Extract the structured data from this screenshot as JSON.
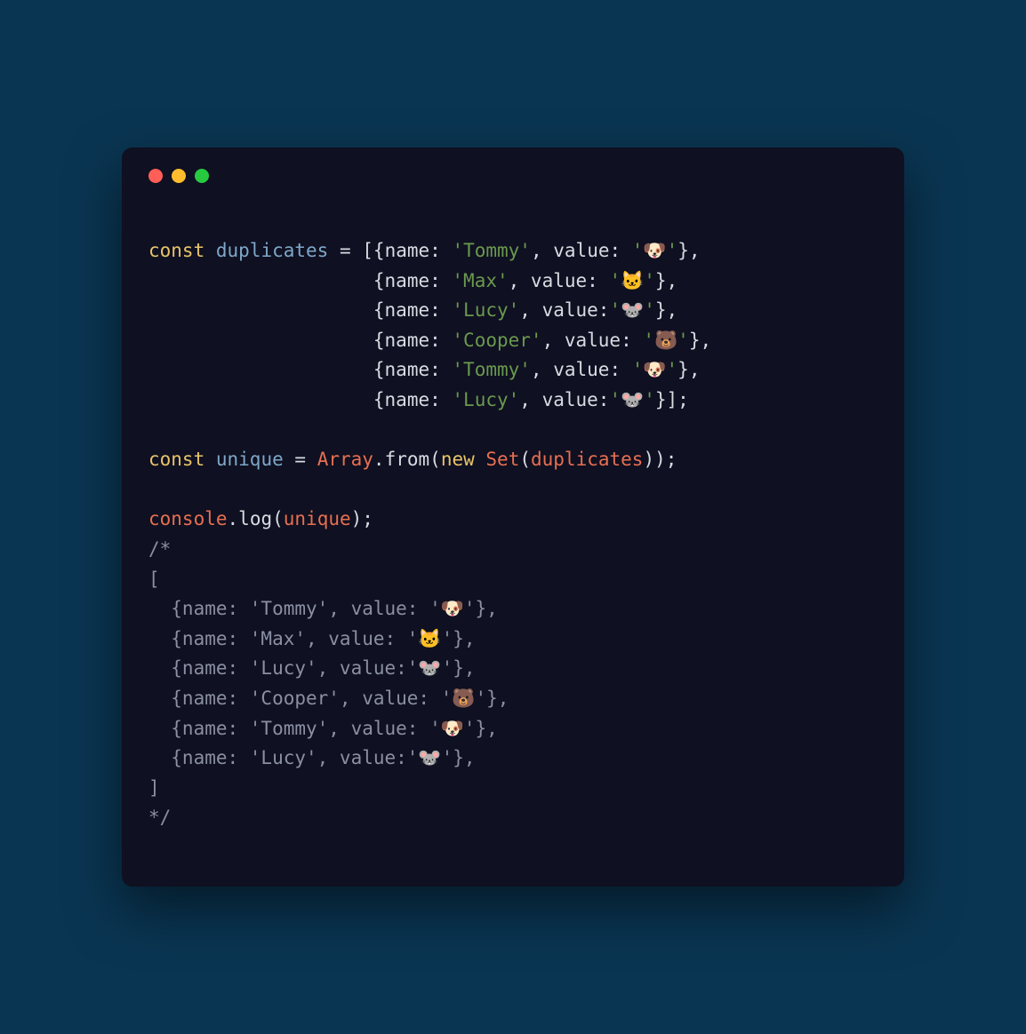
{
  "colors": {
    "page_bg": "#0a3552",
    "window_bg": "#0f1021",
    "traffic_red": "#ff5f56",
    "traffic_yellow": "#ffbd2e",
    "traffic_green": "#27c93f",
    "keyword": "#e9c46a",
    "variable": "#7fa7c9",
    "text": "#d7dce2",
    "string": "#6a994e",
    "class": "#e76f51",
    "comment": "#8a8fa3"
  },
  "code": {
    "l1": {
      "kw": "const",
      "sp1": " ",
      "var": "duplicates",
      "sp2": " ",
      "eq": "=",
      "sp3": " ",
      "br": "[{",
      "p1": "name",
      "c1": ": ",
      "s1": "'Tommy'",
      "cm": ", ",
      "p2": "value",
      "c2": ": ",
      "s2": "'🐶'",
      "end": "},"
    },
    "l2": {
      "pad": "                    ",
      "br": "{",
      "p1": "name",
      "c1": ": ",
      "s1": "'Max'",
      "cm": ", ",
      "p2": "value",
      "c2": ": ",
      "s2": "'🐱'",
      "end": "},"
    },
    "l3": {
      "pad": "                    ",
      "br": "{",
      "p1": "name",
      "c1": ": ",
      "s1": "'Lucy'",
      "cm": ", ",
      "p2": "value",
      "c2": ":",
      "s2": "'🐭'",
      "end": "},"
    },
    "l4": {
      "pad": "                    ",
      "br": "{",
      "p1": "name",
      "c1": ": ",
      "s1": "'Cooper'",
      "cm": ", ",
      "p2": "value",
      "c2": ": ",
      "s2": "'🐻'",
      "end": "},"
    },
    "l5": {
      "pad": "                    ",
      "br": "{",
      "p1": "name",
      "c1": ": ",
      "s1": "'Tommy'",
      "cm": ", ",
      "p2": "value",
      "c2": ": ",
      "s2": "'🐶'",
      "end": "},"
    },
    "l6": {
      "pad": "                    ",
      "br": "{",
      "p1": "name",
      "c1": ": ",
      "s1": "'Lucy'",
      "cm": ", ",
      "p2": "value",
      "c2": ":",
      "s2": "'🐭'",
      "end": "}];"
    },
    "l7": "",
    "l8": {
      "kw": "const",
      "sp1": " ",
      "var": "unique",
      "sp2": " ",
      "eq": "=",
      "sp3": " ",
      "cls1": "Array",
      "dot1": ".",
      "fn1": "from",
      "op1": "(",
      "kw2": "new",
      "sp4": " ",
      "cls2": "Set",
      "op2": "(",
      "arg": "duplicates",
      "op3": "));"
    },
    "l9": "",
    "l10": {
      "cls": "console",
      "dot": ".",
      "fn": "log",
      "op1": "(",
      "arg": "unique",
      "op2": ");"
    },
    "c1": "/*",
    "c2": "[",
    "c3": "  {name: 'Tommy', value: '🐶'},",
    "c4": "  {name: 'Max', value: '🐱'},",
    "c5": "  {name: 'Lucy', value:'🐭'},",
    "c6": "  {name: 'Cooper', value: '🐻'},",
    "c7": "  {name: 'Tommy', value: '🐶'},",
    "c8": "  {name: 'Lucy', value:'🐭'},",
    "c9": "]",
    "c10": "*/"
  }
}
